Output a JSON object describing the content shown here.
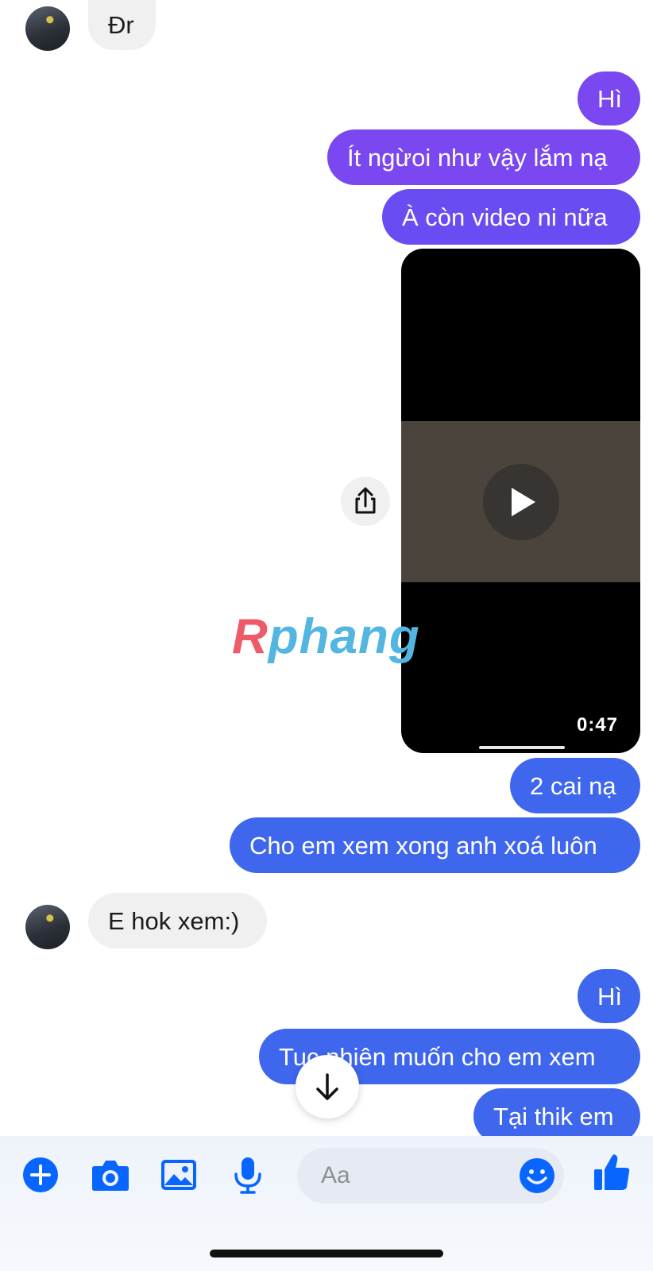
{
  "messages": [
    {
      "id": "m1",
      "direction": "incoming",
      "text": "Đr"
    },
    {
      "id": "m2",
      "direction": "outgoing",
      "text": "Hì"
    },
    {
      "id": "m3",
      "direction": "outgoing",
      "text": "Ít ngừoi như vậy lắm nạ"
    },
    {
      "id": "m4",
      "direction": "outgoing",
      "text": "À còn video ni nữa"
    },
    {
      "id": "m5",
      "direction": "outgoing",
      "type": "video",
      "duration": "0:47"
    },
    {
      "id": "m6",
      "direction": "outgoing",
      "text": "2 cai nạ"
    },
    {
      "id": "m7",
      "direction": "outgoing",
      "text": "Cho em xem xong anh xoá luôn"
    },
    {
      "id": "m8",
      "direction": "incoming",
      "text": "E hok xem:)"
    },
    {
      "id": "m9",
      "direction": "outgoing",
      "text": "Hì"
    },
    {
      "id": "m10",
      "direction": "outgoing",
      "text": "Tuc nhiên muốn cho em xem"
    },
    {
      "id": "m11",
      "direction": "outgoing",
      "text": "Tại thik em"
    }
  ],
  "watermark": {
    "text_first": "R",
    "text_rest": "phang"
  },
  "composer": {
    "placeholder": "Aa"
  },
  "icons": {
    "add": "plus-circle-icon",
    "camera": "camera-icon",
    "gallery": "image-icon",
    "voice": "microphone-icon",
    "emoji": "smiley-icon",
    "like": "thumbs-up-icon",
    "share": "share-icon",
    "scroll": "arrow-down-icon",
    "play": "play-icon"
  },
  "colors": {
    "accent": "#0866ff",
    "bubble_purple": "#7b47f1",
    "bubble_blue": "#3f67ee",
    "bubble_incoming": "#f0f0f0"
  }
}
